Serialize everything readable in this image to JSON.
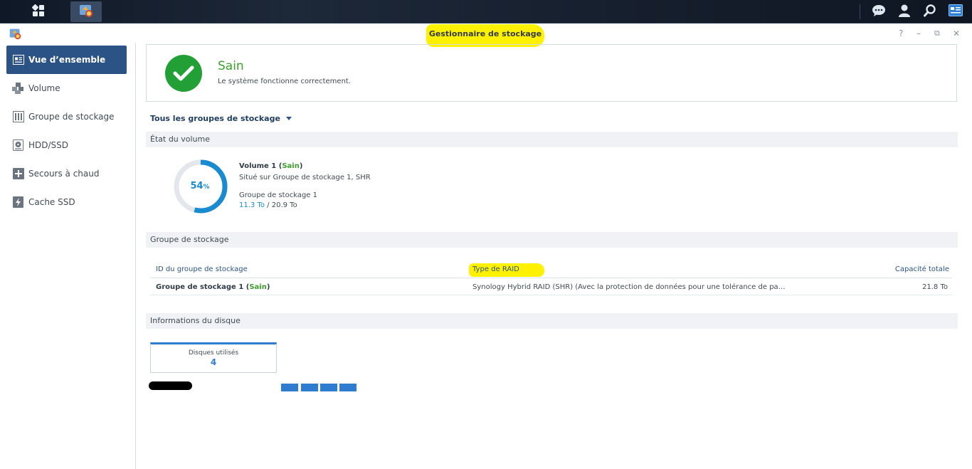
{
  "window": {
    "title": "Gestionnaire de stockage"
  },
  "window_controls": {
    "help": "?",
    "minimize": "–",
    "restore": "⧉",
    "close": "✕"
  },
  "sidebar": {
    "items": [
      {
        "label": "Vue d’ensemble",
        "icon": "overview-icon",
        "active": true
      },
      {
        "label": "Volume",
        "icon": "volume-icon",
        "active": false
      },
      {
        "label": "Groupe de stockage",
        "icon": "storage-pool-icon",
        "active": false
      },
      {
        "label": "HDD/SSD",
        "icon": "hdd-icon",
        "active": false
      },
      {
        "label": "Secours à chaud",
        "icon": "hot-spare-icon",
        "active": false
      },
      {
        "label": "Cache SSD",
        "icon": "ssd-cache-icon",
        "active": false
      }
    ]
  },
  "status": {
    "title": "Sain",
    "description": "Le système fonctionne correctement."
  },
  "filter": {
    "label": "Tous les groupes de stockage"
  },
  "volume_section": {
    "heading": "État du volume",
    "percent": "54",
    "percent_unit": "%",
    "usage_fraction": 0.54,
    "name": "Volume 1",
    "status": "Sain",
    "location": "Situé sur Groupe de stockage 1, SHR",
    "group": "Groupe de stockage 1",
    "used": "11.3 To",
    "total": "20.9 To"
  },
  "pool_section": {
    "heading": "Groupe de stockage",
    "columns": {
      "id": "ID du groupe de stockage",
      "raid": "Type de RAID",
      "capacity": "Capacité totale"
    },
    "rows": [
      {
        "name": "Groupe de stockage 1",
        "status": "Sain",
        "raid": "Synology Hybrid RAID (SHR) (Avec la protection de données pour une tolérance de pa…",
        "capacity": "21.8 To"
      }
    ]
  },
  "disk_section": {
    "heading": "Informations du disque",
    "card_label": "Disques utilisés",
    "card_value": "4"
  },
  "colors": {
    "accent": "#2b5386",
    "healthy": "#3aa12a",
    "usage": "#1a8bd0",
    "highlight": "#fff100"
  }
}
